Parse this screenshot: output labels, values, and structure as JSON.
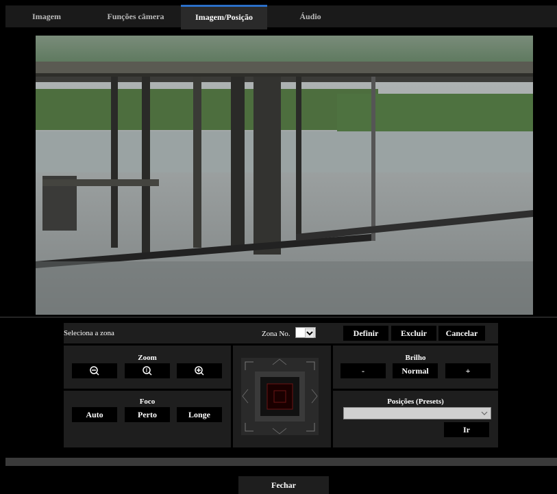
{
  "tabs": [
    {
      "label": "Imagem",
      "active": false
    },
    {
      "label": "Funções câmera",
      "active": false
    },
    {
      "label": "Imagem/Posição",
      "active": true
    },
    {
      "label": "Áudio",
      "active": false
    }
  ],
  "zone": {
    "select_label": "Seleciona a zona",
    "zone_no_label": "Zona No.",
    "define_button": "Definir",
    "delete_button": "Excluir",
    "cancel_button": "Cancelar"
  },
  "zoom": {
    "label": "Zoom",
    "icons": [
      "zoom-out-icon",
      "zoom-reset-icon",
      "zoom-in-icon"
    ]
  },
  "focus": {
    "label": "Foco",
    "auto": "Auto",
    "near": "Perto",
    "far": "Longe"
  },
  "brightness": {
    "label": "Brilho",
    "minus": "-",
    "normal": "Normal",
    "plus": "+"
  },
  "presets": {
    "label": "Posições (Presets)",
    "selected": "",
    "go_button": "Ir"
  },
  "footer": {
    "close_button": "Fechar"
  },
  "colors": {
    "active_tab_accent": "#2b70c9",
    "panel_bg": "#1e1e1e",
    "button_bg": "#000000"
  }
}
